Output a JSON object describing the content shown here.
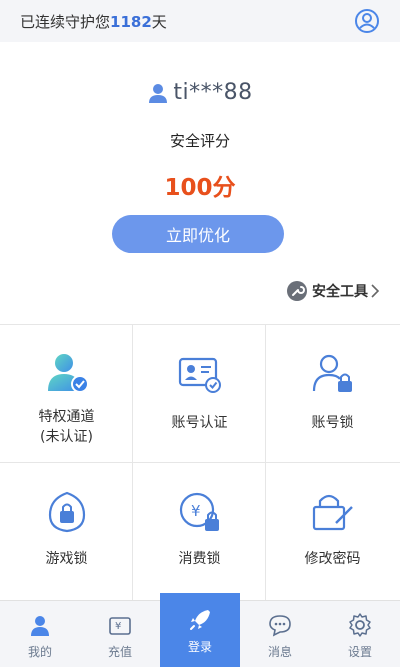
{
  "header": {
    "guard_prefix": "已连续守护您",
    "guard_days": "1182",
    "guard_suffix": "天"
  },
  "account": {
    "username": "ti***88",
    "score_label": "安全评分",
    "score_value": "100分",
    "optimize_label": "立即优化",
    "tools_label": "安全工具"
  },
  "features": [
    {
      "label_line1": "特权通道",
      "label_line2": "(未认证)"
    },
    {
      "label_line1": "账号认证",
      "label_line2": ""
    },
    {
      "label_line1": "账号锁",
      "label_line2": ""
    },
    {
      "label_line1": "游戏锁",
      "label_line2": ""
    },
    {
      "label_line1": "消费锁",
      "label_line2": ""
    },
    {
      "label_line1": "修改密码",
      "label_line2": ""
    }
  ],
  "tabs": [
    {
      "label": "我的",
      "icon": "person-icon"
    },
    {
      "label": "充值",
      "icon": "wallet-icon"
    },
    {
      "label": "登录",
      "icon": "rocket-icon"
    },
    {
      "label": "消息",
      "icon": "chat-icon"
    },
    {
      "label": "设置",
      "icon": "gear-icon"
    }
  ],
  "colors": {
    "accent": "#4b86e8",
    "button": "#6c97ec",
    "score": "#e8501c",
    "days": "#3a6fd8"
  }
}
